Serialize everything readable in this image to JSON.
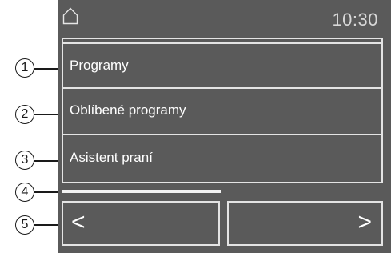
{
  "status_bar": {
    "home_icon": "home-icon",
    "time": "10:30"
  },
  "menu": {
    "items": [
      {
        "label": "Programy"
      },
      {
        "label": "Oblíbené programy"
      },
      {
        "label": "Asistent praní"
      }
    ]
  },
  "navigation": {
    "prev_label": "<",
    "next_label": ">"
  },
  "callouts": [
    "1",
    "2",
    "3",
    "4",
    "5"
  ],
  "colors": {
    "screen_background": "#5a5a5a",
    "frame_lines": "#e4e4e4",
    "text": "#ffffff"
  }
}
